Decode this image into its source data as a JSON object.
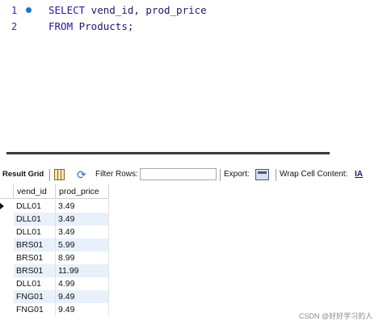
{
  "editor": {
    "lines": [
      {
        "num": "1",
        "keyword": "SELECT",
        "rest": " vend_id, prod_price"
      },
      {
        "num": "2",
        "keyword": "FROM",
        "rest": " Products;"
      }
    ]
  },
  "toolbar": {
    "result_grid_label": "Result Grid",
    "filter_label": "Filter Rows:",
    "filter_value": "",
    "export_label": "Export:",
    "wrap_label": "Wrap Cell Content:",
    "wrap_icon_glyph": "IA"
  },
  "grid": {
    "columns": [
      "vend_id",
      "prod_price"
    ],
    "rows": [
      [
        "DLL01",
        "3.49"
      ],
      [
        "DLL01",
        "3.49"
      ],
      [
        "DLL01",
        "3.49"
      ],
      [
        "BRS01",
        "5.99"
      ],
      [
        "BRS01",
        "8.99"
      ],
      [
        "BRS01",
        "11.99"
      ],
      [
        "DLL01",
        "4.99"
      ],
      [
        "FNG01",
        "9.49"
      ],
      [
        "FNG01",
        "9.49"
      ]
    ],
    "current_row": 0
  },
  "watermark": "CSDN @好好学习的人",
  "colors": {
    "keyword": "#1a1aa8",
    "row_alt": "#e8f0fb",
    "breakpoint_dot": "#1e6fd9"
  }
}
